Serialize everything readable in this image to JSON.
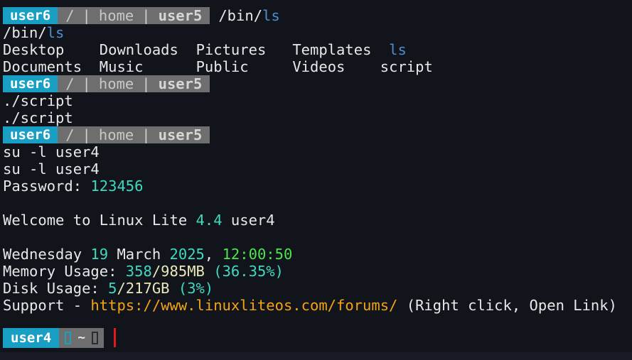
{
  "terminal": {
    "title": "terminal",
    "background_color": "#12141c",
    "foreground_color": "#e8e8e8",
    "accent_colors": {
      "user_badge": "#1a9fc4",
      "path_segment": "#6e6e6e",
      "blue": "#4e8fd1",
      "teal": "#3fd9c0",
      "green": "#4ce64c",
      "cream": "#e8e8b8",
      "orange": "#f5a315",
      "cursor": "#e01b1b"
    }
  },
  "prompt1": {
    "user": "user6",
    "crumb_root": "/",
    "sep": "|",
    "crumb_home": "home",
    "crumb_user": "user5",
    "command_prefix": "/bin/",
    "command_target": "ls"
  },
  "prompt2": {
    "user": "user6",
    "crumb_root": "/",
    "sep": "|",
    "crumb_home": "home",
    "crumb_user": "user5"
  },
  "prompt3": {
    "user": "user6",
    "crumb_root": "/",
    "sep": "|",
    "crumb_home": "home",
    "crumb_user": "user5"
  },
  "output": {
    "echo_bin_ls_prefix": "/bin/",
    "echo_bin_ls_target": "ls",
    "ls_row1": {
      "col1": "Desktop",
      "col2": "Downloads",
      "col3": "Pictures",
      "col4": "Templates",
      "col5": "ls"
    },
    "ls_row2": {
      "col1": "Documents",
      "col2": "Music",
      "col3": "Public",
      "col4": "Videos",
      "col5": "script"
    },
    "script_command": "./script",
    "script_output": "./script",
    "su_command": "su -l user4",
    "su_echo": "su -l user4",
    "password_label": "Password: ",
    "password_value": "123456",
    "welcome_prefix": "Welcome to Linux Lite ",
    "welcome_version": "4.4",
    "welcome_suffix": " user4",
    "date_weekday": "Wednesday ",
    "date_day": "19",
    "date_month": " March ",
    "date_year": "2025",
    "date_comma": ", ",
    "date_time": "12:00:50",
    "memory_label": "Memory Usage: ",
    "memory_used": "358",
    "memory_total": "/985MB",
    "memory_space": " ",
    "memory_percent": "(36.35%)",
    "disk_label": "Disk Usage: ",
    "disk_used": "5",
    "disk_total": "/217GB",
    "disk_space": " ",
    "disk_percent": "(3%)",
    "support_label": "Support - ",
    "support_url": "https://www.linuxliteos.com/forums/",
    "support_hint": " (Right click, Open Link)"
  },
  "bottom_prompt": {
    "user": "user4",
    "tilde": "~"
  }
}
